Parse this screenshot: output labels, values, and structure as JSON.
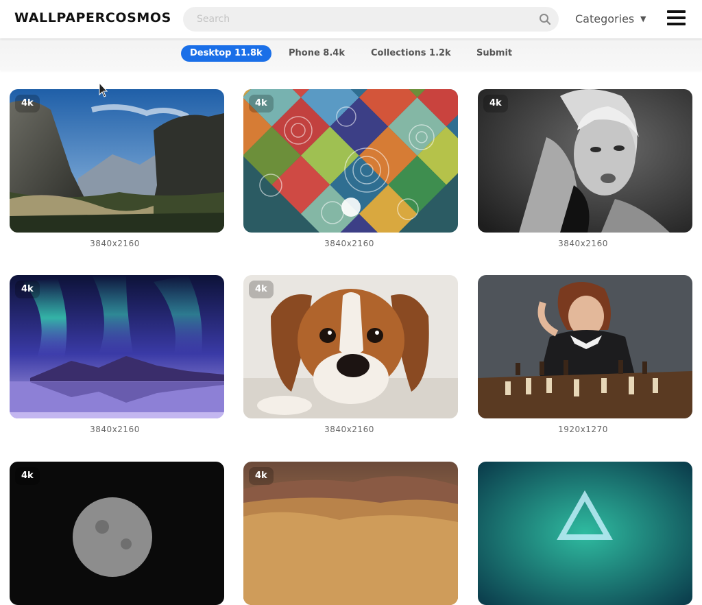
{
  "header": {
    "logo": "WALLPAPERCOSMOS",
    "search_placeholder": "Search",
    "search_icon": "search-icon",
    "categories_label": "Categories",
    "categories_arrow": "▼",
    "menu_icon": "hamburger-menu-icon"
  },
  "tabs": [
    {
      "label": "Desktop 11.8k",
      "active": true
    },
    {
      "label": "Phone 8.4k",
      "active": false
    },
    {
      "label": "Collections 1.2k",
      "active": false
    },
    {
      "label": "Submit",
      "active": false
    }
  ],
  "wallpapers": [
    {
      "badge": "4k",
      "resolution": "3840x2160",
      "subject": "mountain-valley"
    },
    {
      "badge": "4k",
      "resolution": "3840x2160",
      "subject": "mandala-pattern"
    },
    {
      "badge": "4k",
      "resolution": "3840x2160",
      "subject": "woman-portrait-bw"
    },
    {
      "badge": "4k",
      "resolution": "3840x2160",
      "subject": "aurora-lake"
    },
    {
      "badge": "4k",
      "resolution": "3840x2160",
      "subject": "puppy"
    },
    {
      "badge": "",
      "resolution": "1920x1270",
      "subject": "chess-player"
    },
    {
      "badge": "4k",
      "resolution": "",
      "subject": "moon"
    },
    {
      "badge": "4k",
      "resolution": "",
      "subject": "desert-sunset-hills"
    },
    {
      "badge": "",
      "resolution": "",
      "subject": "nebula-triangle"
    }
  ],
  "colors": {
    "accent": "#1a6fe8"
  }
}
